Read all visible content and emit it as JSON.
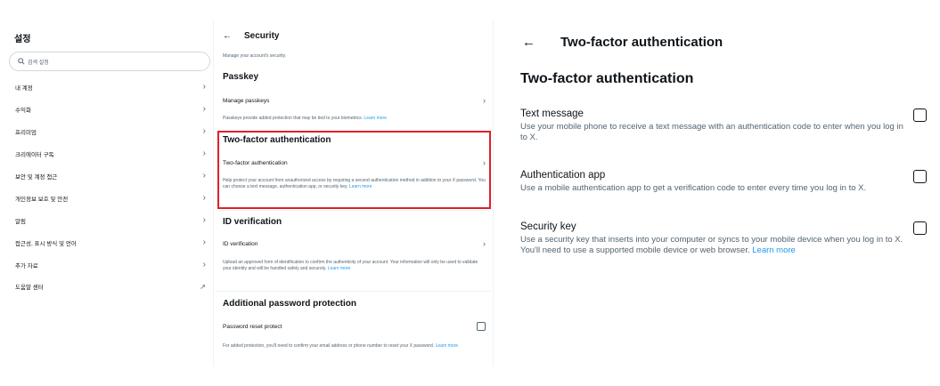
{
  "settings": {
    "title": "설정",
    "search_placeholder": "검색 설정",
    "items": [
      {
        "label": "내 계정",
        "icon": "chevron-right-icon"
      },
      {
        "label": "수익화",
        "icon": "chevron-right-icon"
      },
      {
        "label": "프리미엄",
        "icon": "chevron-right-icon"
      },
      {
        "label": "크리에이터 구독",
        "icon": "chevron-right-icon"
      },
      {
        "label": "보안 및 계정 접근",
        "icon": "chevron-right-icon"
      },
      {
        "label": "개인정보 보호 및 안전",
        "icon": "chevron-right-icon"
      },
      {
        "label": "알림",
        "icon": "chevron-right-icon"
      },
      {
        "label": "접근성, 표시 방식 및 언어",
        "icon": "chevron-right-icon"
      },
      {
        "label": "추가 자료",
        "icon": "chevron-right-icon"
      },
      {
        "label": "도움말 센터",
        "icon": "external-link-icon"
      }
    ]
  },
  "security": {
    "title": "Security",
    "description": "Manage your account's security.",
    "passkey": {
      "heading": "Passkey",
      "row_label": "Manage passkeys",
      "note": "Passkeys provide added protection that may be tied to your biometrics.",
      "learn_more": "Learn more"
    },
    "two_factor": {
      "heading": "Two-factor authentication",
      "row_label": "Two-factor authentication",
      "note": "Help protect your account from unauthorized access by requiring a second authentication method in addition to your X password. You can choose a text message, authentication app, or security key.",
      "learn_more": "Learn more"
    },
    "id_verification": {
      "heading": "ID verification",
      "row_label": "ID verification",
      "note": "Upload an approved form of identification to confirm the authenticity of your account. Your information will only be used to validate your identity and will be handled safely and securely.",
      "learn_more": "Learn more"
    },
    "password_protection": {
      "heading": "Additional password protection",
      "row_label": "Password reset protect",
      "note": "For added protection, you'll need to confirm your email address or phone number to reset your X password.",
      "learn_more": "Learn more"
    }
  },
  "two_factor_page": {
    "header": "Two-factor authentication",
    "title": "Two-factor authentication",
    "options": [
      {
        "label": "Text message",
        "description": "Use your mobile phone to receive a text message with an authentication code to enter when you log in to X."
      },
      {
        "label": "Authentication app",
        "description": "Use a mobile authentication app to get a verification code to enter every time you log in to X."
      },
      {
        "label": "Security key",
        "description": "Use a security key that inserts into your computer or syncs to your mobile device when you log in to X. You'll need to use a supported mobile device or web browser.",
        "learn_more": "Learn more"
      }
    ]
  },
  "colors": {
    "accent": "#1d9bf0",
    "highlight_border": "#e0202a",
    "text_primary": "#0f1419",
    "text_secondary": "#536471"
  }
}
